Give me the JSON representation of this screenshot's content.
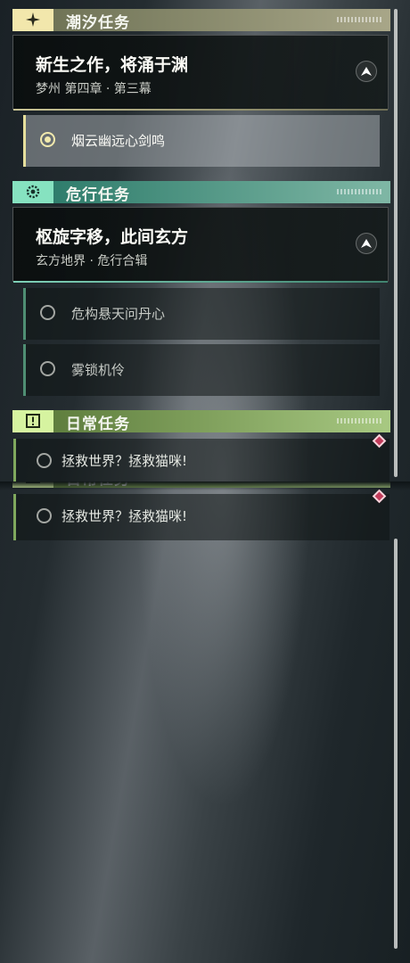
{
  "sections": {
    "tide": {
      "title": "潮汐任务",
      "icon": "sparkle-icon",
      "color": "#f2e7ac",
      "quest": {
        "title": "新生之作，将涌于渊",
        "subtitle": "梦州 第四章 · 第三幕"
      },
      "objectives": [
        {
          "label": "烟云幽远心剑鸣",
          "selected": true
        }
      ]
    },
    "danger": {
      "title": "危行任务",
      "icon": "gear-eye-icon",
      "color": "#86e2c0",
      "quest": {
        "title": "枢旋字移，此间玄方",
        "subtitle": "玄方地界 · 危行合辑"
      },
      "objectives": [
        {
          "label": "危构悬天问丹心"
        },
        {
          "label": "雾锁机伶"
        }
      ]
    },
    "daily": {
      "title": "日常任务",
      "icon": "alert-box-icon",
      "color": "#d6f3a0",
      "objectives": [
        {
          "label": "拯救世界？拯救猫咪!"
        }
      ]
    }
  }
}
